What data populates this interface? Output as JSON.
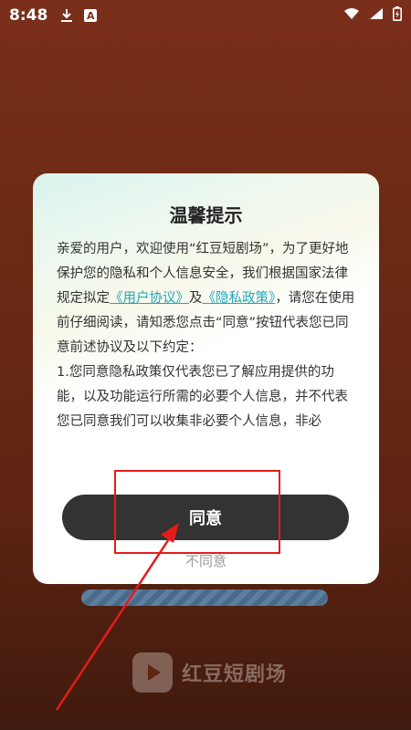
{
  "statusbar": {
    "time": "8:48"
  },
  "dialog": {
    "title": "温馨提示",
    "body": {
      "p1_start": "亲爱的用户，欢迎使用“红豆短剧场”，为了更好地保护您的隐私和个人信息安全，我们根据国家法律规定拟定",
      "link_user": "《用户协议》",
      "and": "及",
      "link_privacy": "《隐私政策》",
      "p1_end": "，请您在使用前仔细阅读，请知悉您点击“同意”按钮代表您已同意前述协议及以下约定：",
      "p2": "1.您同意隐私政策仅代表您已了解应用提供的功能，以及功能运行所需的必要个人信息，并不代表您已同意我们可以收集非必要个人信息，非必"
    },
    "agree_label": "同意",
    "disagree_label": "不同意"
  },
  "brand": {
    "name": "红豆短剧场"
  },
  "colors": {
    "link": "#23a6b7",
    "agree_bg": "#333333",
    "annotation": "#e51b1b"
  },
  "icons": [
    "download-icon",
    "accessibility-a-icon",
    "wifi-icon",
    "signal-icon",
    "battery-icon",
    "play-logo-icon"
  ]
}
